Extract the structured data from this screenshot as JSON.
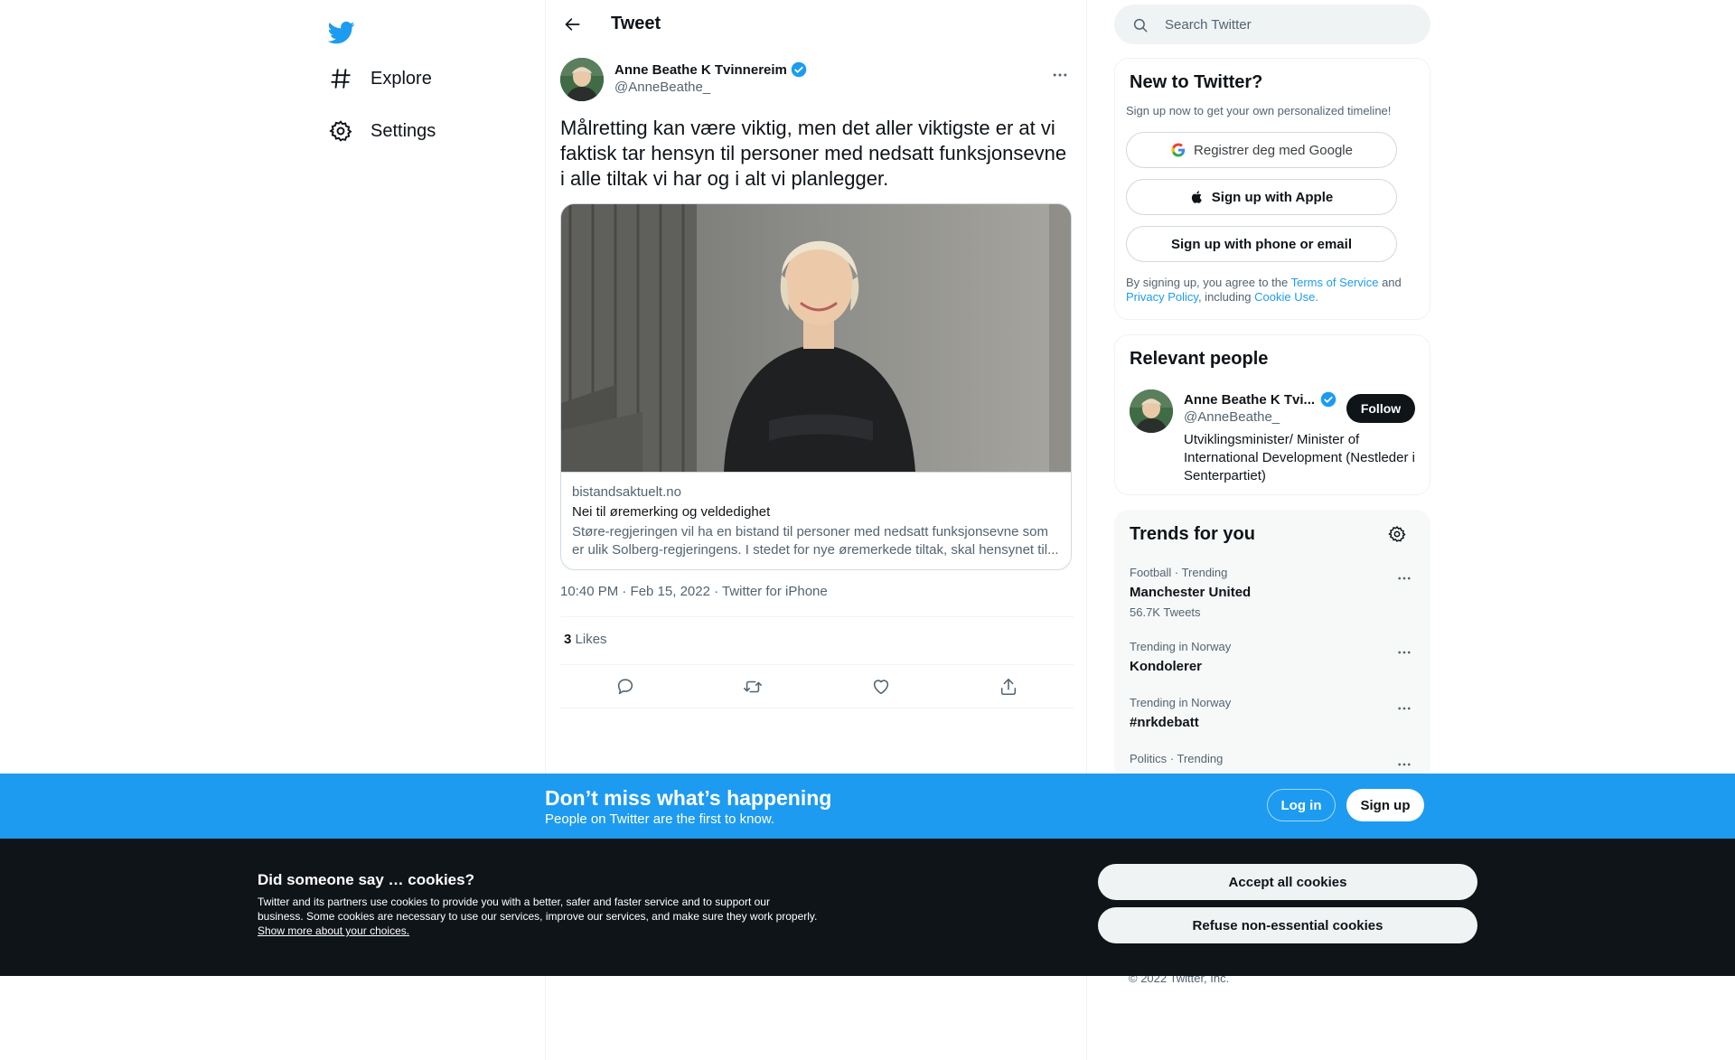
{
  "colors": {
    "brand": "#1d9bf0",
    "text": "#0f1419",
    "muted": "#536471",
    "dark": "#0f1419"
  },
  "nav": {
    "logo_icon": "twitter-bird-icon",
    "items": [
      {
        "label": "Explore",
        "icon": "hashtag-icon"
      },
      {
        "label": "Settings",
        "icon": "gear-icon"
      }
    ]
  },
  "header": {
    "title": "Tweet",
    "back_icon": "arrow-left-icon"
  },
  "tweet": {
    "author_name": "Anne Beathe K Tvinnereim",
    "author_handle": "@AnneBeathe_",
    "verified_icon": "verified-badge-icon",
    "text": "Målretting kan være viktig, men det aller viktigste er at vi faktisk tar hensyn til personer med nedsatt funksjonsevne i alle tiltak vi har og i alt vi planlegger.",
    "card": {
      "domain": "bistandsaktuelt.no",
      "title": "Nei til øremerking og veldedighet",
      "desc_line1": "Støre-regjeringen vil ha en bistand til personer med nedsatt funksjonsevne som",
      "desc_line2": "er ulik Solberg-regjeringens. I stedet for nye øremerkede tiltak, skal hensynet til..."
    },
    "timestamp": "10:40 PM · Feb 15, 2022 · Twitter for iPhone",
    "likes_count": "3",
    "likes_label": "Likes",
    "actions": [
      "reply-icon",
      "retweet-icon",
      "like-icon",
      "share-icon"
    ]
  },
  "search": {
    "placeholder": "Search Twitter"
  },
  "signup": {
    "title": "New to Twitter?",
    "subtitle": "Sign up now to get your own personalized timeline!",
    "google_label": "Registrer deg med Google",
    "apple_label": "Sign up with Apple",
    "phone_label": "Sign up with phone or email",
    "legal_prefix": "By signing up, you agree to the",
    "terms": "Terms of Service",
    "and": "and",
    "privacy": "Privacy Policy",
    "including": ", including",
    "cookie_use": "Cookie Use."
  },
  "people": {
    "title": "Relevant people",
    "name": "Anne Beathe K Tvi...",
    "handle": "@AnneBeathe_",
    "follow_label": "Follow",
    "bio": "Utviklingsminister/ Minister of International Development (Nestleder i Senterpartiet)"
  },
  "trends": {
    "title": "Trends for you",
    "items": [
      {
        "meta": "Football · Trending",
        "name": "Manchester United",
        "count": "56.7K Tweets"
      },
      {
        "meta": "Trending in Norway",
        "name": "Kondolerer",
        "count": ""
      },
      {
        "meta": "Trending in Norway",
        "name": "#nrkdebatt",
        "count": ""
      },
      {
        "meta": "Politics · Trending",
        "name": "",
        "count": ""
      }
    ]
  },
  "footer": {
    "copyright": "© 2022 Twitter, Inc."
  },
  "banner": {
    "title": "Don’t miss what’s happening",
    "subtitle": "People on Twitter are the first to know.",
    "login_label": "Log in",
    "signup_label": "Sign up"
  },
  "cookies": {
    "title": "Did someone say … cookies?",
    "text": "Twitter and its partners use cookies to provide you with a better, safer and faster service and to support our business. Some cookies are necessary to use our services, improve our services, and make sure they work properly.",
    "link": "Show more about your choices.",
    "accept_label": "Accept all cookies",
    "refuse_label": "Refuse non-essential cookies"
  }
}
